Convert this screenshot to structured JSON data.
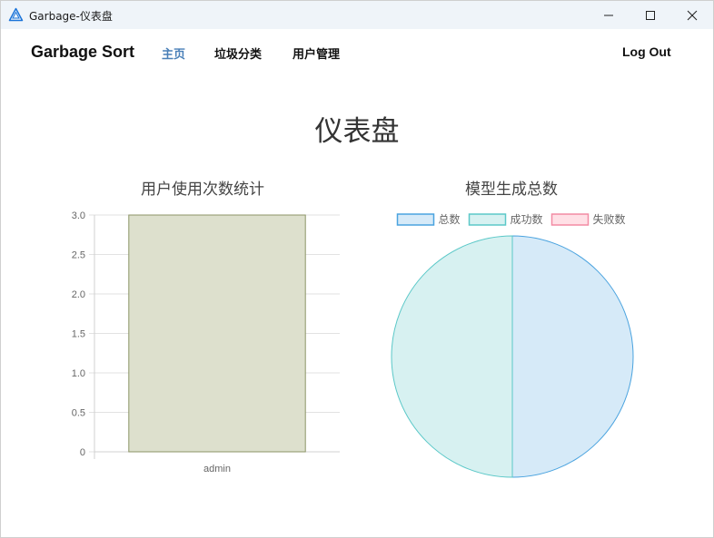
{
  "window": {
    "title": "Garbage-仪表盘",
    "app_icon": "recycle-triangle-icon",
    "controls": [
      "minimize-icon",
      "maximize-icon",
      "close-icon"
    ]
  },
  "navbar": {
    "brand": "Garbage Sort",
    "links": [
      {
        "label": "主页",
        "active": true
      },
      {
        "label": "垃圾分类",
        "active": false
      },
      {
        "label": "用户管理",
        "active": false
      }
    ],
    "logout": "Log Out",
    "active_color": "#4a80b8"
  },
  "page": {
    "title": "仪表盘"
  },
  "chart_data": [
    {
      "type": "bar",
      "title": "用户使用次数统计",
      "categories": [
        "admin"
      ],
      "values": [
        3
      ],
      "ylim": [
        0,
        3
      ],
      "yticks": [
        "0",
        "0.5",
        "1.0",
        "1.5",
        "2.0",
        "2.5",
        "3.0"
      ],
      "grid": true,
      "colors": {
        "fill": "#dde0cd",
        "stroke": "#8c9467"
      }
    },
    {
      "type": "pie",
      "title": "模型生成总数",
      "legend_position": "top",
      "labels": [
        "总数",
        "成功数",
        "失败数"
      ],
      "values": [
        1,
        1,
        0
      ],
      "colors": [
        {
          "fill": "#d6eaf8",
          "stroke": "#4aa3df"
        },
        {
          "fill": "#d7f1f1",
          "stroke": "#5bc8c8"
        },
        {
          "fill": "#ffe0e6",
          "stroke": "#f28ba4"
        }
      ]
    }
  ]
}
